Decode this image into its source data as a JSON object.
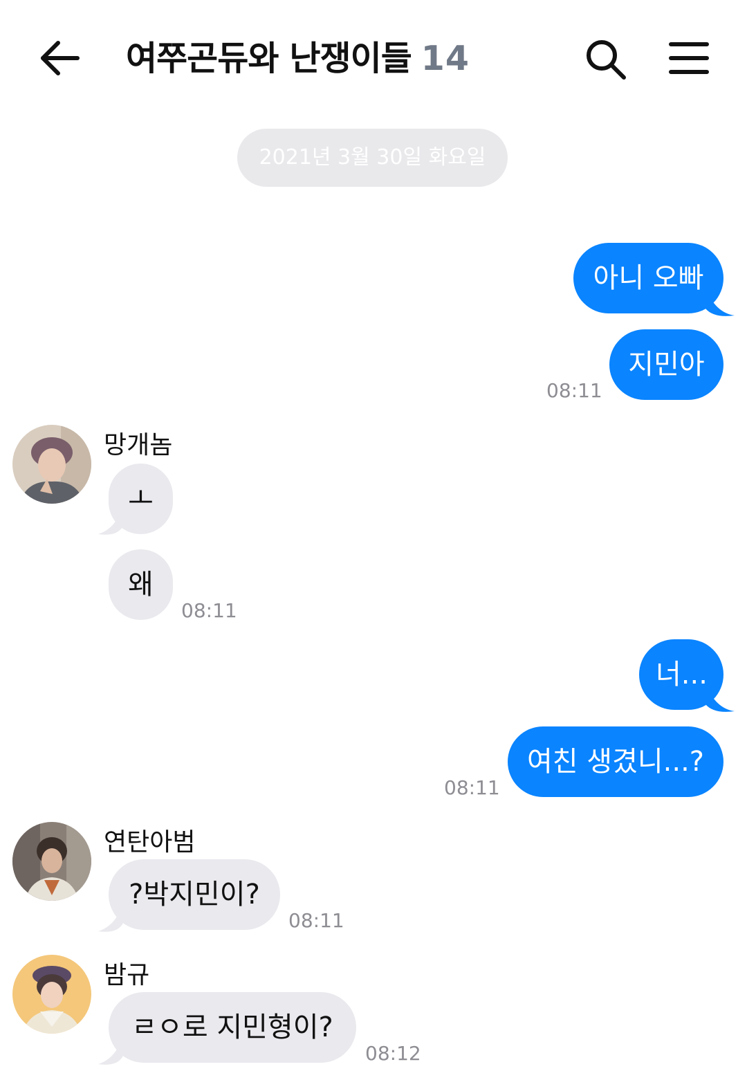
{
  "header": {
    "title": "여쭈곤듀와 난쟁이들",
    "member_count": "14",
    "back_icon": "back-arrow-icon",
    "search_icon": "search-icon",
    "menu_icon": "hamburger-menu-icon"
  },
  "date_divider": "2021년 3월 30일 화요일",
  "colors": {
    "outgoing_bubble": "#0a84ff",
    "incoming_bubble": "#e9e9ee",
    "timestamp": "#8d8d93",
    "count": "#707987"
  },
  "messages": [
    {
      "from": "me",
      "text": "아니 오빠"
    },
    {
      "from": "me",
      "text": "지민아",
      "time": "08:11"
    },
    {
      "from": "망개놈",
      "text": "ㅗ"
    },
    {
      "from": "망개놈",
      "text": "왜",
      "time": "08:11"
    },
    {
      "from": "me",
      "text": "너..."
    },
    {
      "from": "me",
      "text": "여친 생겼니...?",
      "time": "08:11"
    },
    {
      "from": "연탄아범",
      "text": "?박지민이?",
      "time": "08:11"
    },
    {
      "from": "밤규",
      "text": "ㄹㅇ로 지민형이?",
      "time": "08:12"
    }
  ],
  "senders": [
    "망개놈",
    "연탄아범",
    "밤규"
  ]
}
